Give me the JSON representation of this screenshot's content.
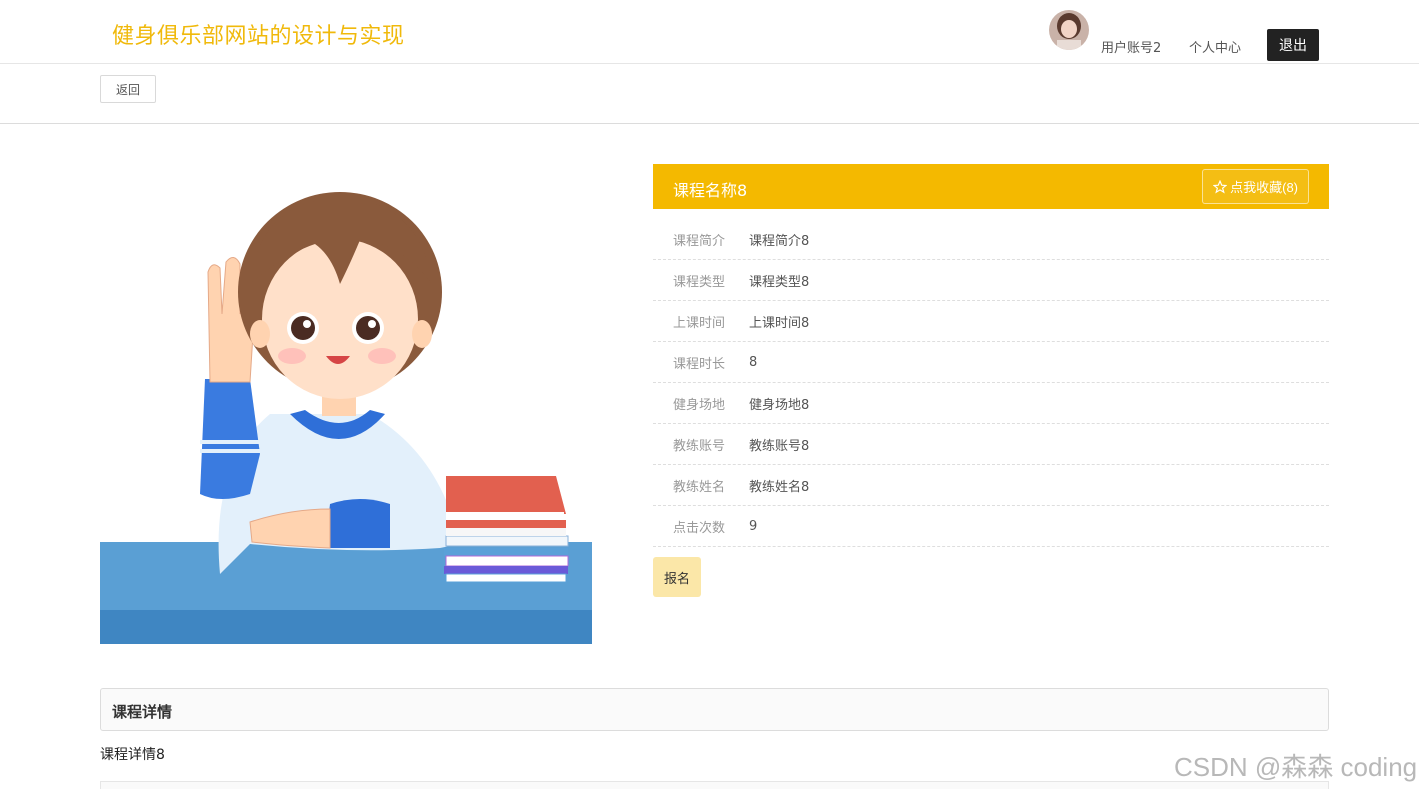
{
  "header": {
    "site_title": "健身俱乐部网站的设计与实现",
    "username": "用户账号2",
    "center_label": "个人中心",
    "logout_label": "退出"
  },
  "backbar": {
    "back_label": "返回"
  },
  "course": {
    "name": "课程名称8",
    "favorite_label": "点我收藏(8)",
    "rows": [
      {
        "label": "课程简介",
        "value": "课程简介8"
      },
      {
        "label": "课程类型",
        "value": "课程类型8"
      },
      {
        "label": "上课时间",
        "value": "上课时间8"
      },
      {
        "label": "课程时长",
        "value": "8"
      },
      {
        "label": "健身场地",
        "value": "健身场地8"
      },
      {
        "label": "教练账号",
        "value": "教练账号8"
      },
      {
        "label": "教练姓名",
        "value": "教练姓名8"
      },
      {
        "label": "点击次数",
        "value": "9"
      }
    ],
    "signup_label": "报名"
  },
  "detail": {
    "title": "课程详情",
    "text": "课程详情8"
  },
  "watermark": "CSDN @森森 coding",
  "colors": {
    "accent": "#f4b900",
    "title": "#f0b90b",
    "signup": "#fbe7a8"
  }
}
